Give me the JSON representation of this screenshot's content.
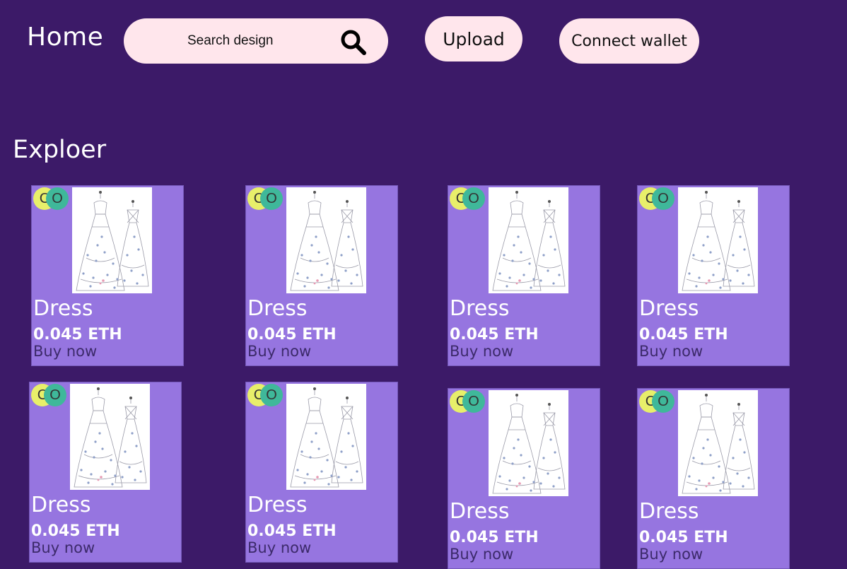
{
  "header": {
    "home_label": "Home",
    "search": {
      "placeholder": "Search design",
      "icon": "search-icon"
    },
    "upload_label": "Upload",
    "connect_label": "Connect wallet"
  },
  "explore": {
    "heading": "Exploer",
    "cards": [
      {
        "badge_c": "C",
        "badge_o": "O",
        "title": "Dress",
        "price": "0.045 ETH",
        "cta": "Buy now"
      },
      {
        "badge_c": "C",
        "badge_o": "O",
        "title": "Dress",
        "price": "0.045 ETH",
        "cta": "Buy now"
      },
      {
        "badge_c": "C",
        "badge_o": "O",
        "title": "Dress",
        "price": "0.045 ETH",
        "cta": "Buy now"
      },
      {
        "badge_c": "C",
        "badge_o": "O",
        "title": "Dress",
        "price": "0.045 ETH",
        "cta": "Buy now"
      },
      {
        "badge_c": "C",
        "badge_o": "O",
        "title": "Dress",
        "price": "0.045 ETH",
        "cta": "Buy now"
      },
      {
        "badge_c": "C",
        "badge_o": "O",
        "title": "Dress",
        "price": "0.045 ETH",
        "cta": "Buy now"
      },
      {
        "badge_c": "C",
        "badge_o": "O",
        "title": "Dress",
        "price": "0.045 ETH",
        "cta": "Buy now"
      },
      {
        "badge_c": "C",
        "badge_o": "O",
        "title": "Dress",
        "price": "0.045 ETH",
        "cta": "Buy now"
      }
    ]
  },
  "colors": {
    "background": "#3c1a68",
    "card": "#9675e0",
    "pill": "#ffe6ec",
    "badge_c": "#e8ef6a",
    "badge_o": "#3fb89a"
  }
}
